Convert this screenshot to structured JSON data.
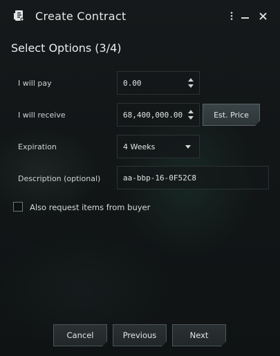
{
  "window": {
    "title": "Create Contract",
    "step_title": "Select Options (3/4)"
  },
  "form": {
    "pay": {
      "label": "I will pay",
      "value": "0.00"
    },
    "receive": {
      "label": "I will receive",
      "value": "68,400,000.00",
      "est_price_label": "Est. Price"
    },
    "expiration": {
      "label": "Expiration",
      "value": "4 Weeks"
    },
    "description": {
      "label": "Description (optional)",
      "value": "aa-bbp-16-0F52C8"
    },
    "request_items": {
      "label": "Also request items from buyer",
      "checked": false
    }
  },
  "buttons": {
    "cancel": "Cancel",
    "previous": "Previous",
    "next": "Next"
  },
  "icons": {
    "app": "contract-icon",
    "menu": "kebab-menu-icon",
    "minimize": "minimize-icon",
    "close": "close-icon"
  }
}
